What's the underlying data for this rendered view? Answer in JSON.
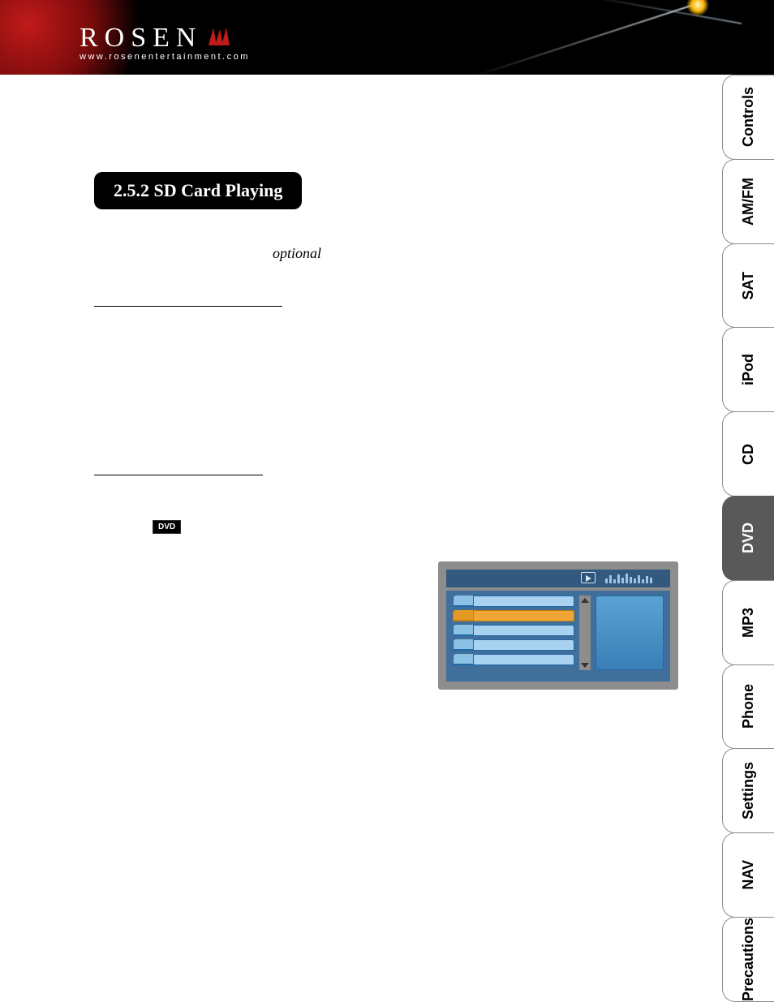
{
  "logo": {
    "brand": "ROSEN",
    "url": "www.rosenentertainment.com"
  },
  "tabs": [
    {
      "id": "controls",
      "label": "Controls",
      "active": false
    },
    {
      "id": "amfm",
      "label": "AM/FM",
      "active": false
    },
    {
      "id": "sat",
      "label": "SAT",
      "active": false
    },
    {
      "id": "ipod",
      "label": "iPod",
      "active": false
    },
    {
      "id": "cd",
      "label": "CD",
      "active": false
    },
    {
      "id": "dvd",
      "label": "DVD",
      "active": true
    },
    {
      "id": "mp3",
      "label": "MP3",
      "active": false
    },
    {
      "id": "phone",
      "label": "Phone",
      "active": false
    },
    {
      "id": "settings",
      "label": "Settings",
      "active": false
    },
    {
      "id": "nav",
      "label": "NAV",
      "active": false
    },
    {
      "id": "precautions",
      "label": "Precautions",
      "active": false
    }
  ],
  "section": {
    "title": "2.5.2 SD Card Playing"
  },
  "optional_note": "optional",
  "subheads": {
    "first_visible_text": "",
    "second_visible_text": ""
  },
  "dvd_chip_label": "DVD"
}
